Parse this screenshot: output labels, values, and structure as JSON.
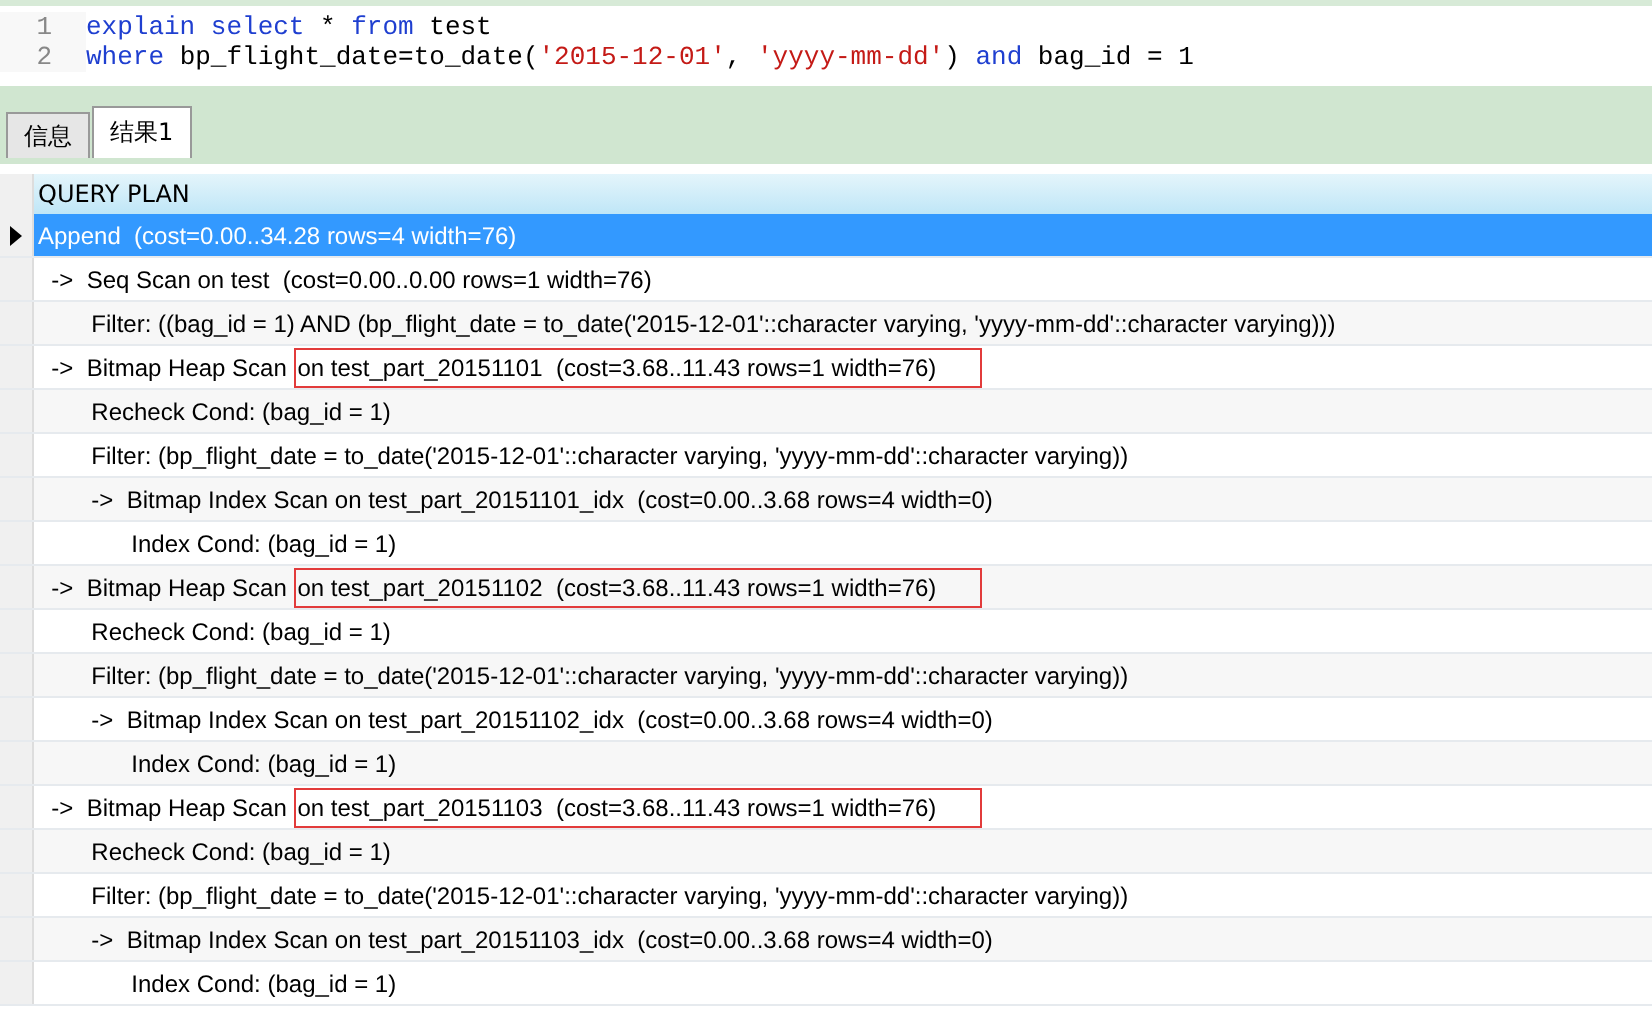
{
  "editor": {
    "lines": [
      {
        "number": "1",
        "tokens": [
          {
            "kind": "keyword",
            "text": "explain select"
          },
          {
            "kind": "plain",
            "text": " * "
          },
          {
            "kind": "keyword",
            "text": "from"
          },
          {
            "kind": "plain",
            "text": " test"
          }
        ]
      },
      {
        "number": "2",
        "tokens": [
          {
            "kind": "keyword",
            "text": "where"
          },
          {
            "kind": "plain",
            "text": " bp_flight_date=to_date("
          },
          {
            "kind": "string",
            "text": "'2015-12-01'"
          },
          {
            "kind": "plain",
            "text": ", "
          },
          {
            "kind": "string",
            "text": "'yyyy-mm-dd'"
          },
          {
            "kind": "plain",
            "text": ") "
          },
          {
            "kind": "keyword",
            "text": "and"
          },
          {
            "kind": "plain",
            "text": " bag_id = 1"
          }
        ]
      }
    ]
  },
  "tabs": [
    {
      "label": "信息",
      "selected": false
    },
    {
      "label": "结果1",
      "selected": true
    }
  ],
  "grid": {
    "column": "QUERY PLAN",
    "rows": [
      {
        "text": "Append  (cost=0.00..34.28 rows=4 width=76)",
        "selected": true
      },
      {
        "text": "  ->  Seq Scan on test  (cost=0.00..0.00 rows=1 width=76)",
        "selected": false
      },
      {
        "text": "        Filter: ((bag_id = 1) AND (bp_flight_date = to_date('2015-12-01'::character varying, 'yyyy-mm-dd'::character varying)))",
        "selected": false
      },
      {
        "text": "  ->  Bitmap Heap Scan ",
        "boxed": "on test_part_20151101  (cost=3.68..11.43 rows=1 width=76)",
        "selected": false
      },
      {
        "text": "        Recheck Cond: (bag_id = 1)",
        "selected": false
      },
      {
        "text": "        Filter: (bp_flight_date = to_date('2015-12-01'::character varying, 'yyyy-mm-dd'::character varying))",
        "selected": false
      },
      {
        "text": "        ->  Bitmap Index Scan on test_part_20151101_idx  (cost=0.00..3.68 rows=4 width=0)",
        "selected": false
      },
      {
        "text": "              Index Cond: (bag_id = 1)",
        "selected": false
      },
      {
        "text": "  ->  Bitmap Heap Scan ",
        "boxed": "on test_part_20151102  (cost=3.68..11.43 rows=1 width=76)",
        "selected": false
      },
      {
        "text": "        Recheck Cond: (bag_id = 1)",
        "selected": false
      },
      {
        "text": "        Filter: (bp_flight_date = to_date('2015-12-01'::character varying, 'yyyy-mm-dd'::character varying))",
        "selected": false
      },
      {
        "text": "        ->  Bitmap Index Scan on test_part_20151102_idx  (cost=0.00..3.68 rows=4 width=0)",
        "selected": false
      },
      {
        "text": "              Index Cond: (bag_id = 1)",
        "selected": false
      },
      {
        "text": "  ->  Bitmap Heap Scan ",
        "boxed": "on test_part_20151103  (cost=3.68..11.43 rows=1 width=76)",
        "selected": false
      },
      {
        "text": "        Recheck Cond: (bag_id = 1)",
        "selected": false
      },
      {
        "text": "        Filter: (bp_flight_date = to_date('2015-12-01'::character varying, 'yyyy-mm-dd'::character varying))",
        "selected": false
      },
      {
        "text": "        ->  Bitmap Index Scan on test_part_20151103_idx  (cost=0.00..3.68 rows=4 width=0)",
        "selected": false
      },
      {
        "text": "              Index Cond: (bag_id = 1)",
        "selected": false
      }
    ]
  }
}
